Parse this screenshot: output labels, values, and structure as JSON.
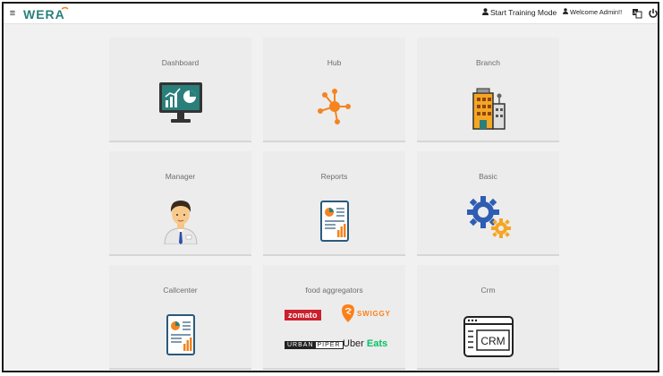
{
  "header": {
    "logo_text": "WERA",
    "training_label": "Start Training Mode",
    "welcome_label": "Welcome Admin!!",
    "menu_icon": "hamburger-icon",
    "lang_icon": "translate-icon",
    "power_icon": "power-icon"
  },
  "cards": [
    {
      "title": "Dashboard",
      "icon": "monitor-chart-icon"
    },
    {
      "title": "Hub",
      "icon": "hub-network-icon"
    },
    {
      "title": "Branch",
      "icon": "building-icon"
    },
    {
      "title": "Manager",
      "icon": "manager-avatar-icon"
    },
    {
      "title": "Reports",
      "icon": "report-document-icon"
    },
    {
      "title": "Basic",
      "icon": "gears-icon"
    },
    {
      "title": "Callcenter",
      "icon": "report-document-icon"
    },
    {
      "title": "food aggregators",
      "icon": "aggregator-logos"
    },
    {
      "title": "Crm",
      "icon": "crm-window-icon"
    }
  ],
  "aggregators": {
    "zomato": "zomato",
    "swiggy": "SWIGGY",
    "urban": "URBAN",
    "piper": "PIPER",
    "uber": "Uber",
    "eats": "Eats"
  },
  "crm_label": "CRM",
  "colors": {
    "accent_orange": "#f5841f",
    "teal": "#2a7f7b",
    "gear_blue": "#2e5db3",
    "card_bg": "#ececec"
  }
}
